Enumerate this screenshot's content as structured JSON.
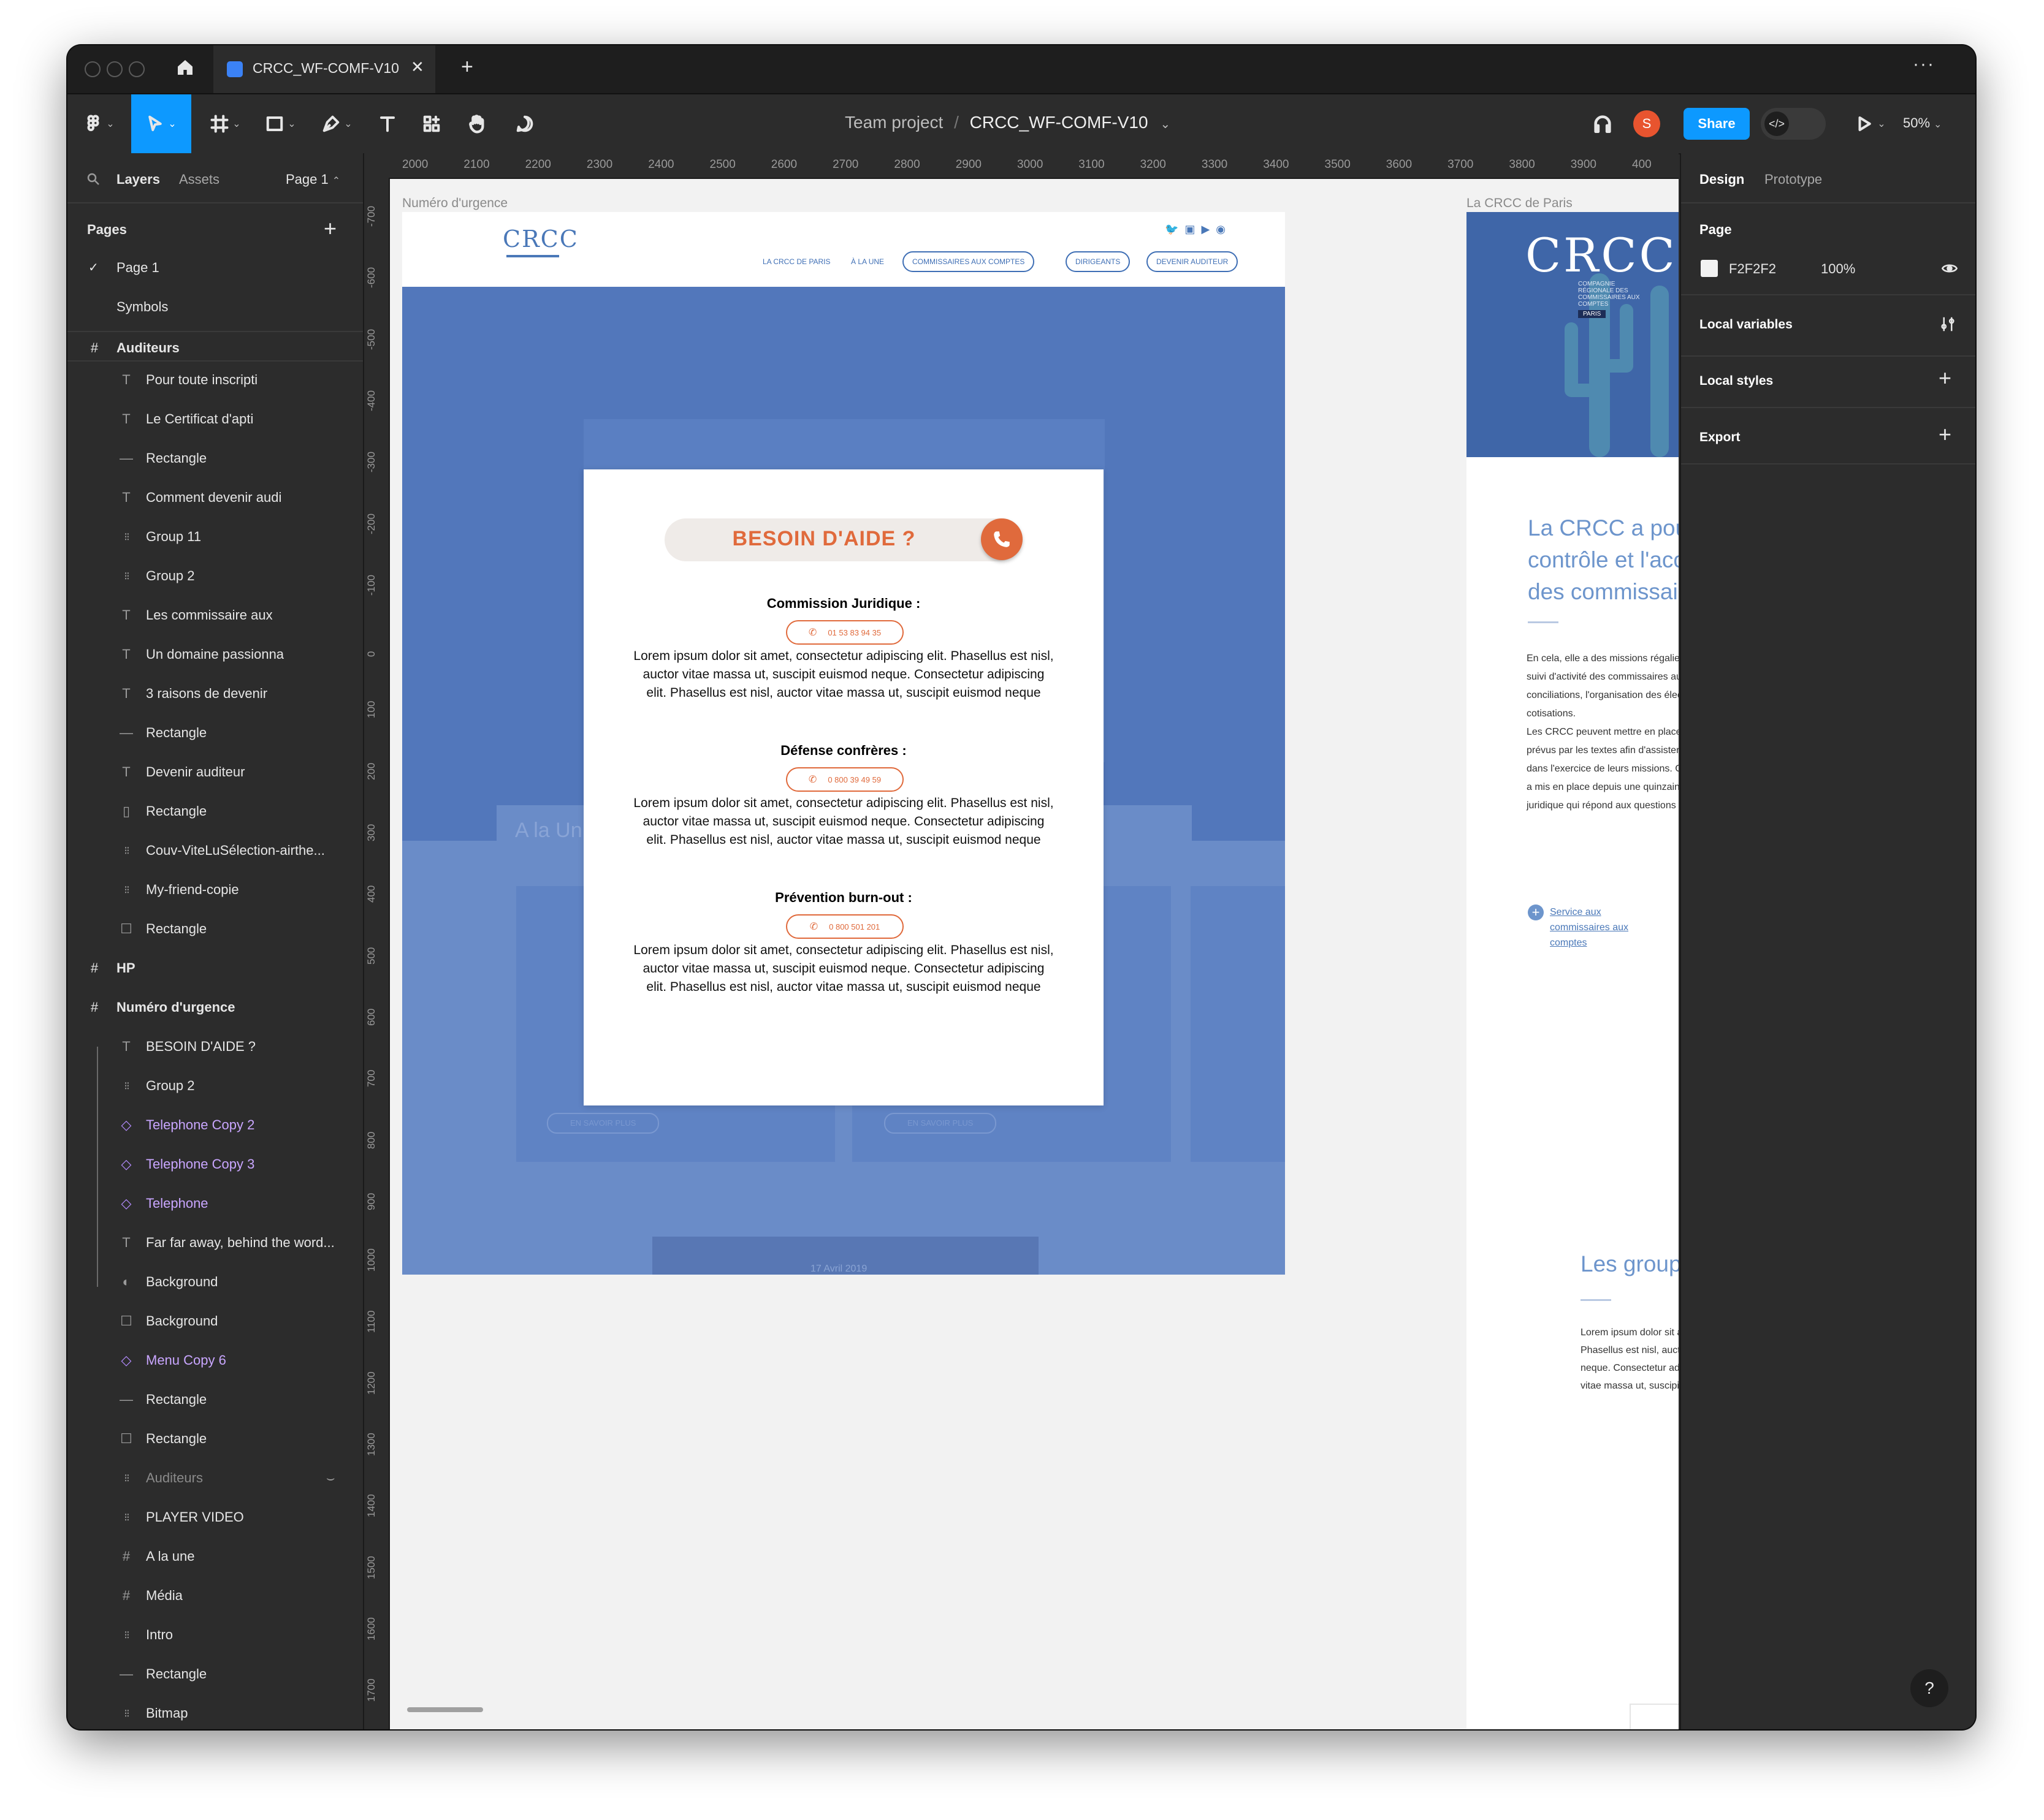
{
  "tabs": {
    "file_tab": "CRCC_WF-COMF-V10"
  },
  "breadcrumb": {
    "project": "Team project",
    "separator": "/",
    "file": "CRCC_WF-COMF-V10"
  },
  "toolbar": {
    "share_label": "Share",
    "zoom": "50%",
    "avatar_initial": "S"
  },
  "left_panel": {
    "tabs": [
      "Layers",
      "Assets"
    ],
    "page_selector": "Page 1",
    "pages_title": "Pages",
    "pages": [
      "Page 1",
      "Symbols"
    ],
    "layers": [
      {
        "label": "Auditeurs",
        "kind": "frame"
      },
      {
        "label": "Pour toute inscripti",
        "kind": "text"
      },
      {
        "label": "Le Certificat d'apti",
        "kind": "text"
      },
      {
        "label": "Rectangle",
        "kind": "line"
      },
      {
        "label": "Comment devenir audi",
        "kind": "text"
      },
      {
        "label": "Group 11",
        "kind": "group"
      },
      {
        "label": "Group 2",
        "kind": "group"
      },
      {
        "label": "Les commissaire aux",
        "kind": "text"
      },
      {
        "label": "Un domaine passionna",
        "kind": "text"
      },
      {
        "label": "3 raisons de devenir",
        "kind": "text"
      },
      {
        "label": "Rectangle",
        "kind": "line"
      },
      {
        "label": "Devenir auditeur",
        "kind": "text"
      },
      {
        "label": "Rectangle",
        "kind": "vline"
      },
      {
        "label": "Couv-ViteLuSélection-airthe...",
        "kind": "group"
      },
      {
        "label": "My-friend-copie",
        "kind": "group"
      },
      {
        "label": "Rectangle",
        "kind": "rect"
      },
      {
        "label": "HP",
        "kind": "frame"
      },
      {
        "label": "Numéro d'urgence",
        "kind": "frame"
      },
      {
        "label": "BESOIN D'AIDE ?",
        "kind": "text"
      },
      {
        "label": "Group 2",
        "kind": "group"
      },
      {
        "label": "Telephone Copy 2",
        "kind": "component"
      },
      {
        "label": "Telephone Copy 3",
        "kind": "component"
      },
      {
        "label": "Telephone",
        "kind": "component"
      },
      {
        "label": "Far far away, behind the word...",
        "kind": "text"
      },
      {
        "label": "Background",
        "kind": "mask"
      },
      {
        "label": "Background",
        "kind": "rect"
      },
      {
        "label": "Menu Copy 6",
        "kind": "component"
      },
      {
        "label": "Rectangle",
        "kind": "line"
      },
      {
        "label": "Rectangle",
        "kind": "rect"
      },
      {
        "label": "Auditeurs",
        "kind": "hidden"
      },
      {
        "label": "PLAYER VIDEO",
        "kind": "group"
      },
      {
        "label": "A la une",
        "kind": "frame-small"
      },
      {
        "label": "Média",
        "kind": "frame-small"
      },
      {
        "label": "Intro",
        "kind": "group"
      },
      {
        "label": "Rectangle",
        "kind": "line"
      },
      {
        "label": "Bitmap",
        "kind": "group"
      }
    ]
  },
  "ruler": {
    "top": [
      "2000",
      "2100",
      "2200",
      "2300",
      "2400",
      "2500",
      "2600",
      "2700",
      "2800",
      "2900",
      "3000",
      "3100",
      "3200",
      "3300",
      "3400",
      "3500",
      "3600",
      "3700",
      "3800",
      "3900",
      "400"
    ],
    "left": [
      "-700",
      "-600",
      "-500",
      "-400",
      "-300",
      "-200",
      "-100",
      "0",
      "100",
      "200",
      "300",
      "400",
      "500",
      "600",
      "700",
      "800",
      "900",
      "1000",
      "1100",
      "1200",
      "1300",
      "1400",
      "1500",
      "1600",
      "1700"
    ]
  },
  "canvas": {
    "frame1_label": "Numéro d'urgence",
    "frame2_label": "La CRCC de Paris",
    "logo": "CRCC",
    "nav": {
      "links": [
        "LA CRCC DE PARIS",
        "À LA UNE"
      ],
      "pills": [
        "COMMISSAIRES AUX COMPTES",
        "DIRIGEANTS",
        "DEVENIR AUDITEUR"
      ]
    },
    "bg_faint": {
      "a_la_une": "A la Un",
      "en_savoir_plus": "EN SAVOIR PLUS",
      "date": "17 Avril 2019",
      "plus": "plus"
    },
    "modal": {
      "title": "BESOIN D'AIDE ?",
      "sections": [
        {
          "heading": "Commission Juridique :",
          "phone": "01 53 83 94 35",
          "body": "Lorem ipsum dolor sit amet, consectetur adipiscing elit. Phasellus est nisl, auctor vitae massa ut, suscipit euismod neque. Consectetur adipiscing elit. Phasellus est nisl, auctor vitae massa ut, suscipit euismod neque"
        },
        {
          "heading": "Défense confrères :",
          "phone": "0 800 39 49 59",
          "body": "Lorem ipsum dolor sit amet, consectetur adipiscing elit. Phasellus est nisl, auctor vitae massa ut, suscipit euismod neque. Consectetur adipiscing elit. Phasellus est nisl, auctor vitae massa ut, suscipit euismod neque"
        },
        {
          "heading": "Prévention burn-out :",
          "phone": "0 800 501 201",
          "body": "Lorem ipsum dolor sit amet, consectetur adipiscing elit. Phasellus est nisl, auctor vitae massa ut, suscipit euismod neque. Consectetur adipiscing elit. Phasellus est nisl, auctor vitae massa ut, suscipit euismod neque"
        }
      ]
    },
    "frame2": {
      "logo": "CRCC",
      "logo_sub": [
        "COMPAGNIE",
        "RÉGIONALE DES",
        "COMMISSAIRES AUX",
        "COMPTES"
      ],
      "logo_badge": "PARIS",
      "heading": [
        "La CRCC a pour missi",
        "contrôle et l'accompa",
        "des commissaires aux"
      ],
      "body": [
        "En cela, elle a des missions régaliennes telle",
        "suivi d'activité des commissaires aux compt",
        "conciliations, l'organisation des élections et",
        "cotisations.",
        "Les CRCC peuvent mettre en place par ailleu",
        "prévus par les textes afin d'assister les comm",
        "dans l'exercice de leurs missions. C'est le ca",
        "a mis en place depuis une quinzaine d'anné",
        "juridique qui répond aux questions des com"
      ],
      "link": [
        "Service aux",
        "commissaires aux",
        "comptes"
      ],
      "heading2": "Les groupes de t",
      "body2": [
        "Lorem ipsum dolor sit amet, con",
        "Phasellus est nisl, auctor vitae m",
        "neque. Consectetur adipiscing el",
        "vitae massa ut, suscipit euismod"
      ]
    }
  },
  "right_panel": {
    "tabs": [
      "Design",
      "Prototype"
    ],
    "page_title": "Page",
    "page_color": "F2F2F2",
    "page_opacity": "100%",
    "sections": [
      "Local variables",
      "Local styles",
      "Export"
    ],
    "help": "?"
  },
  "colors": {
    "accent": "#0d99ff",
    "share": "#0d99ff",
    "avatar": "#e8542f",
    "mock_blue": "#5b7fc0",
    "orange": "#e06a3c"
  }
}
